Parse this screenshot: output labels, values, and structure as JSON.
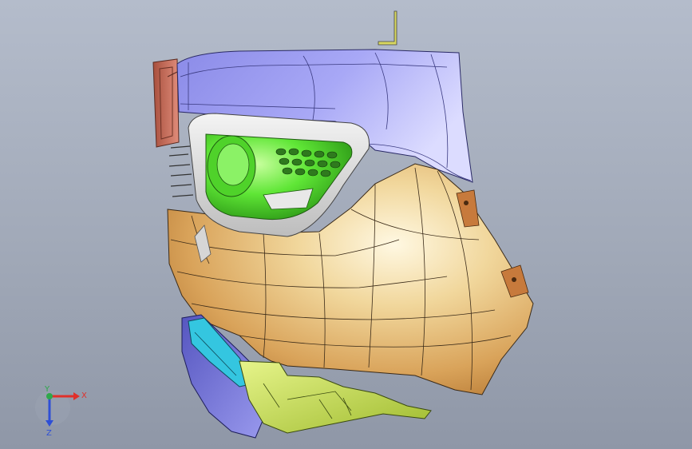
{
  "viewport": {
    "background_top": "#b4bccb",
    "background_bottom": "#8f97a7"
  },
  "triad": {
    "x_label": "X",
    "y_label": "Y",
    "z_label": "Z",
    "x_color": "#e0302a",
    "y_color": "#2ea84a",
    "z_color": "#2e4fd6"
  },
  "parts": {
    "top_cover_color": "#9e9ef2",
    "lower_bumper_color": "#e7c27a",
    "lamp_housing_color": "#6af03b",
    "lamp_bezel_color": "#e6e6e6",
    "rear_bracket_color": "#c2665a",
    "lower_skirt_color": "#6f6fd0",
    "cyan_trim_color": "#34c6e0",
    "lower_bracket_color": "#c8df57",
    "mount_bracket_color": "#c77a3c"
  }
}
